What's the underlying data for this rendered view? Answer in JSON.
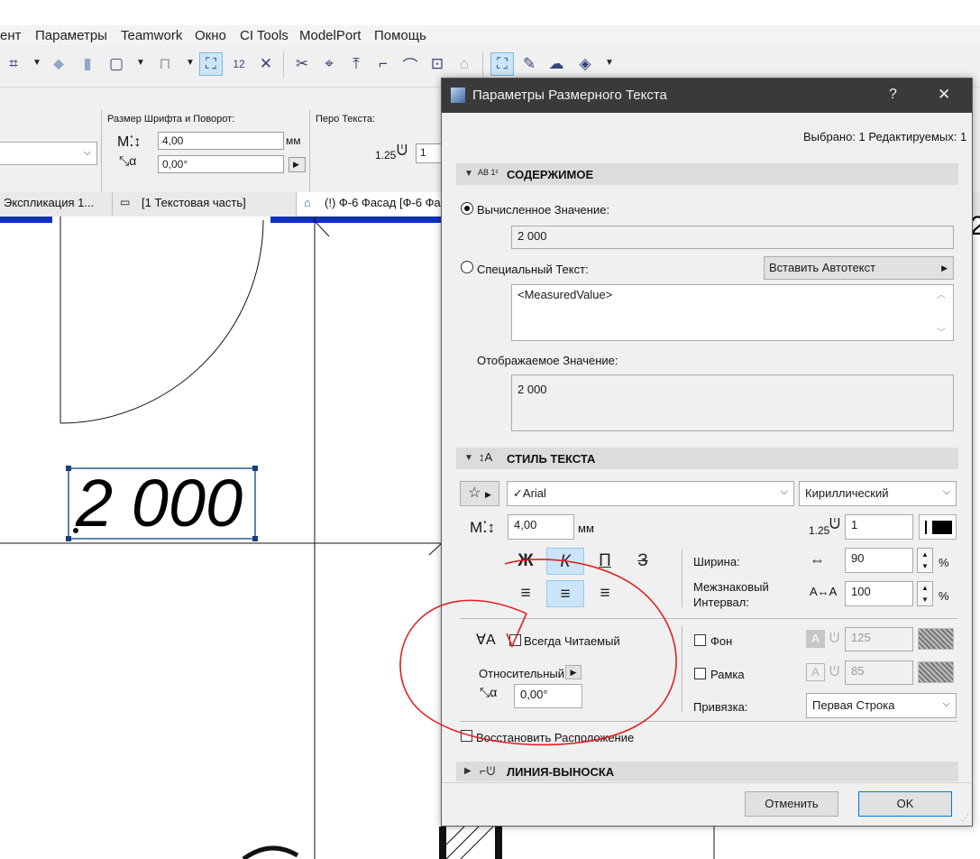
{
  "menu": [
    "ент",
    "Параметры",
    "Teamwork",
    "Окно",
    "CI Tools",
    "ModelPort",
    "Помощь"
  ],
  "infobox": {
    "font_group_label": "Размер Шрифта и Поворот:",
    "font_size": "4,00",
    "font_unit": "мм",
    "angle": "0,00°",
    "pen_label": "Перо Текста:",
    "pen_size": "1.25",
    "pen_value": "1"
  },
  "tabs": [
    "Экспликация 1...",
    "[1 Текстовая часть]",
    "(!) Ф-6 Фасад [Ф-6 Фас"
  ],
  "canvas": {
    "dimension_text": "2 000",
    "right_edge_char": "2"
  },
  "dialog": {
    "title": "Параметры Размерного Текста",
    "help": "?",
    "close": "✕",
    "selection_info": "Выбрано: 1 Редактируемых: 1",
    "content": {
      "header": "СОДЕРЖИМОЕ",
      "icon_text": "AB 1²",
      "calc_label": "Вычисленное Значение:",
      "calc_value": "2 000",
      "special_label": "Специальный Текст:",
      "autotext_button": "Вставить Автотекст",
      "special_value": "<MeasuredValue>",
      "display_label": "Отображаемое Значение:",
      "display_value": "2 000"
    },
    "style": {
      "header": "СТИЛЬ ТЕКСТА",
      "font_name": "Arial",
      "charset": "Кириллический",
      "size": "4,00",
      "size_unit": "мм",
      "pen_size": "1.25",
      "pen": "1",
      "bold": "Ж",
      "italic": "К",
      "underline": "П",
      "strike": "З",
      "width_label": "Ширина:",
      "width_value": "90",
      "spacing_label_1": "Межзнаковый",
      "spacing_label_2": "Интервал:",
      "spacing_value": "100",
      "percent": "%",
      "always_readable": "Всегда Читаемый",
      "relative": "Относительный",
      "angle": "0,00°",
      "background": "Фон",
      "bg_pen": "125",
      "frame": "Рамка",
      "frame_pen": "85",
      "anchor_label": "Привязка:",
      "anchor_value": "Первая Строка",
      "restore": "Восстановить Расположение"
    },
    "leader": {
      "header": "ЛИНИЯ-ВЫНОСКА"
    },
    "cancel": "Отменить",
    "ok": "OK"
  },
  "colors": {
    "accent_blue": "#0078d7",
    "annotation_red": "#e02020",
    "title_bar": "#3a3a3a"
  }
}
